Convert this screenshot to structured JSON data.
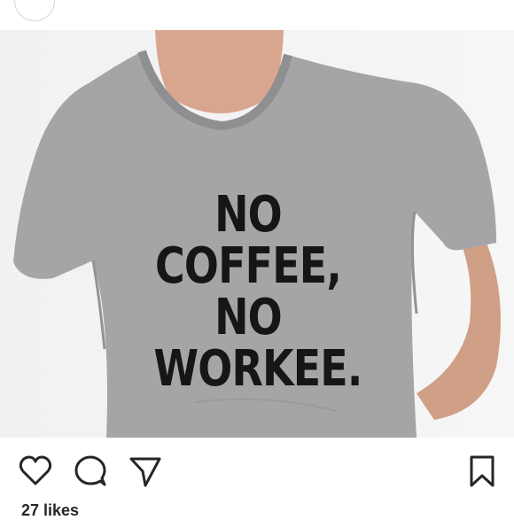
{
  "header": {
    "username": "",
    "avatar_icon": "avatar-circle"
  },
  "post": {
    "image_text": [
      "NO",
      "COFFEE,",
      "NO",
      "WORKEE."
    ]
  },
  "actions": {
    "like_icon": "heart-icon",
    "comment_icon": "comment-icon",
    "share_icon": "send-icon",
    "save_icon": "bookmark-icon"
  },
  "likes_text": "27 likes",
  "colors": {
    "shirt": "#a3a3a5",
    "skin": "#d4a48c",
    "icon_stroke": "#262626"
  }
}
